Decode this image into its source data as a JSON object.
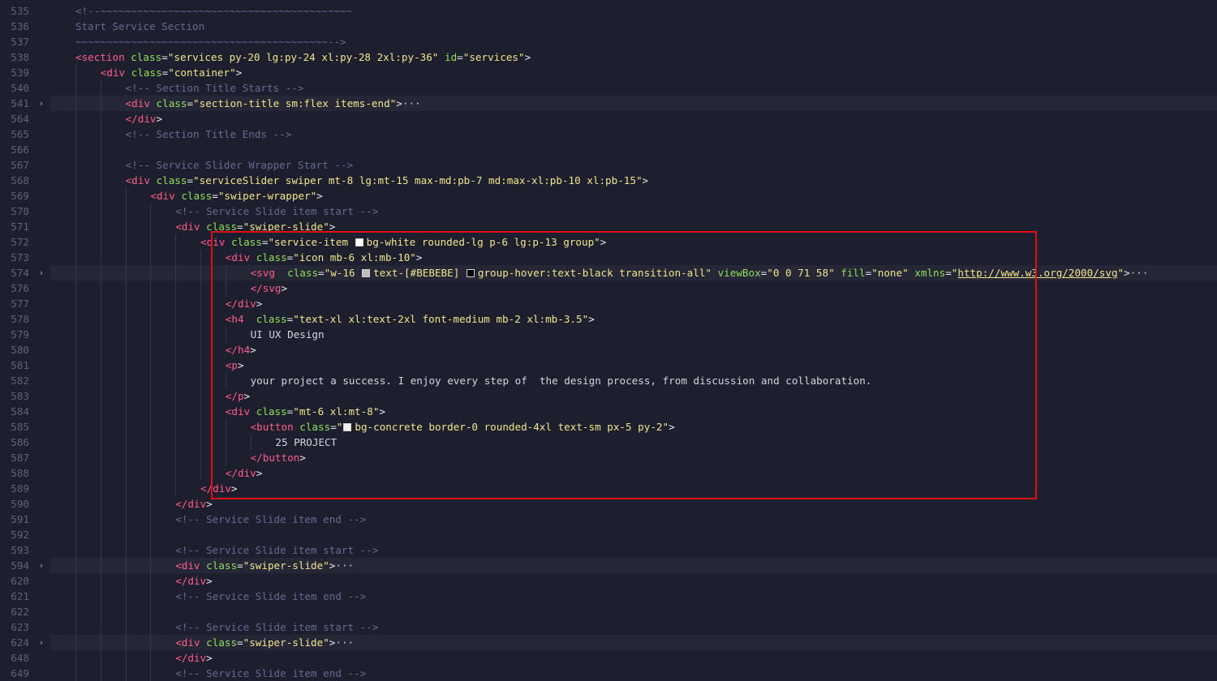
{
  "editor": {
    "lines": [
      {
        "n": "535",
        "indent": 1,
        "tokens": [
          {
            "t": "cmt",
            "v": "<!--~~~~~~~~~~~~~~~~~~~~~~~~~~~~~~~~~~~~~~~~~"
          }
        ]
      },
      {
        "n": "536",
        "indent": 1,
        "tokens": [
          {
            "t": "cmt",
            "v": "Start Service Section"
          }
        ]
      },
      {
        "n": "537",
        "indent": 1,
        "tokens": [
          {
            "t": "cmt",
            "v": "~~~~~~~~~~~~~~~~~~~~~~~~~~~~~~~~~~~~~~~~~-->"
          }
        ]
      },
      {
        "n": "538",
        "indent": 1,
        "tokens": [
          {
            "t": "tag",
            "v": "<section"
          },
          {
            "t": "txt",
            "v": " "
          },
          {
            "t": "attr",
            "v": "class"
          },
          {
            "t": "punc",
            "v": "="
          },
          {
            "t": "str",
            "v": "\"services py-20 lg:py-24 xl:py-28 2xl:py-36\""
          },
          {
            "t": "txt",
            "v": " "
          },
          {
            "t": "attr",
            "v": "id"
          },
          {
            "t": "punc",
            "v": "="
          },
          {
            "t": "str",
            "v": "\"services\""
          },
          {
            "t": "punc",
            "v": ">"
          }
        ]
      },
      {
        "n": "539",
        "indent": 2,
        "tokens": [
          {
            "t": "tag",
            "v": "<div"
          },
          {
            "t": "txt",
            "v": " "
          },
          {
            "t": "attr",
            "v": "class"
          },
          {
            "t": "punc",
            "v": "="
          },
          {
            "t": "str",
            "v": "\"container\""
          },
          {
            "t": "punc",
            "v": ">"
          }
        ]
      },
      {
        "n": "540",
        "indent": 3,
        "tokens": [
          {
            "t": "cmt",
            "v": "<!-- Section Title Starts -->"
          }
        ]
      },
      {
        "n": "541",
        "indent": 3,
        "folded": true,
        "tokens": [
          {
            "t": "tag",
            "v": "<div"
          },
          {
            "t": "txt",
            "v": " "
          },
          {
            "t": "attr",
            "v": "class"
          },
          {
            "t": "punc",
            "v": "="
          },
          {
            "t": "str",
            "v": "\"section-title sm:flex items-end\""
          },
          {
            "t": "punc",
            "v": ">"
          },
          {
            "t": "ellip",
            "v": "···"
          }
        ]
      },
      {
        "n": "564",
        "indent": 3,
        "tokens": [
          {
            "t": "tag",
            "v": "</div"
          },
          {
            "t": "punc",
            "v": ">"
          }
        ]
      },
      {
        "n": "565",
        "indent": 3,
        "tokens": [
          {
            "t": "cmt",
            "v": "<!-- Section Title Ends -->"
          }
        ]
      },
      {
        "n": "566",
        "indent": 3,
        "tokens": []
      },
      {
        "n": "567",
        "indent": 3,
        "tokens": [
          {
            "t": "cmt",
            "v": "<!-- Service Slider Wrapper Start -->"
          }
        ]
      },
      {
        "n": "568",
        "indent": 3,
        "tokens": [
          {
            "t": "tag",
            "v": "<div"
          },
          {
            "t": "txt",
            "v": " "
          },
          {
            "t": "attr",
            "v": "class"
          },
          {
            "t": "punc",
            "v": "="
          },
          {
            "t": "str",
            "v": "\"serviceSlider swiper mt-8 lg:mt-15 max-md:pb-7 md:max-xl:pb-10 xl:pb-15\""
          },
          {
            "t": "punc",
            "v": ">"
          }
        ]
      },
      {
        "n": "569",
        "indent": 4,
        "tokens": [
          {
            "t": "tag",
            "v": "<div"
          },
          {
            "t": "txt",
            "v": " "
          },
          {
            "t": "attr",
            "v": "class"
          },
          {
            "t": "punc",
            "v": "="
          },
          {
            "t": "str",
            "v": "\"swiper-wrapper\""
          },
          {
            "t": "punc",
            "v": ">"
          }
        ]
      },
      {
        "n": "570",
        "indent": 5,
        "tokens": [
          {
            "t": "cmt",
            "v": "<!-- Service Slide item start -->"
          }
        ]
      },
      {
        "n": "571",
        "indent": 5,
        "tokens": [
          {
            "t": "tag",
            "v": "<div"
          },
          {
            "t": "txt",
            "v": " "
          },
          {
            "t": "attr",
            "v": "class"
          },
          {
            "t": "punc",
            "v": "="
          },
          {
            "t": "str",
            "v": "\"swiper-slide\""
          },
          {
            "t": "punc",
            "v": ">"
          }
        ]
      },
      {
        "n": "572",
        "indent": 6,
        "tokens": [
          {
            "t": "tag",
            "v": "<div"
          },
          {
            "t": "txt",
            "v": " "
          },
          {
            "t": "attr",
            "v": "class"
          },
          {
            "t": "punc",
            "v": "="
          },
          {
            "t": "str",
            "v": "\"service-item "
          },
          {
            "t": "swatch",
            "v": "#ffffff"
          },
          {
            "t": "str",
            "v": "bg-white rounded-lg p-6 lg:p-13 group\""
          },
          {
            "t": "punc",
            "v": ">"
          }
        ]
      },
      {
        "n": "573",
        "indent": 7,
        "tokens": [
          {
            "t": "tag",
            "v": "<div"
          },
          {
            "t": "txt",
            "v": " "
          },
          {
            "t": "attr",
            "v": "class"
          },
          {
            "t": "punc",
            "v": "="
          },
          {
            "t": "str",
            "v": "\"icon mb-6 xl:mb-10\""
          },
          {
            "t": "punc",
            "v": ">"
          }
        ]
      },
      {
        "n": "574",
        "indent": 8,
        "folded": true,
        "tokens": [
          {
            "t": "tag",
            "v": "<svg"
          },
          {
            "t": "txt",
            "v": "  "
          },
          {
            "t": "attr",
            "v": "class"
          },
          {
            "t": "punc",
            "v": "="
          },
          {
            "t": "str",
            "v": "\"w-16 "
          },
          {
            "t": "swatch",
            "v": "#BEBEBE"
          },
          {
            "t": "str",
            "v": "text-[#BEBEBE] "
          },
          {
            "t": "swatch",
            "v": "#000000"
          },
          {
            "t": "str",
            "v": "group-hover:text-black transition-all\""
          },
          {
            "t": "txt",
            "v": " "
          },
          {
            "t": "attr",
            "v": "viewBox"
          },
          {
            "t": "punc",
            "v": "="
          },
          {
            "t": "str",
            "v": "\"0 0 71 58\""
          },
          {
            "t": "txt",
            "v": " "
          },
          {
            "t": "attr",
            "v": "fill"
          },
          {
            "t": "punc",
            "v": "="
          },
          {
            "t": "str",
            "v": "\"none\""
          },
          {
            "t": "txt",
            "v": " "
          },
          {
            "t": "attr",
            "v": "xmlns"
          },
          {
            "t": "punc",
            "v": "="
          },
          {
            "t": "str",
            "v": "\""
          },
          {
            "t": "link",
            "v": "http://www.w3.org/2000/svg"
          },
          {
            "t": "str",
            "v": "\""
          },
          {
            "t": "punc",
            "v": ">"
          },
          {
            "t": "ellip",
            "v": "···"
          }
        ]
      },
      {
        "n": "576",
        "indent": 8,
        "tokens": [
          {
            "t": "tag",
            "v": "</svg"
          },
          {
            "t": "punc",
            "v": ">"
          }
        ]
      },
      {
        "n": "577",
        "indent": 7,
        "tokens": [
          {
            "t": "tag",
            "v": "</div"
          },
          {
            "t": "punc",
            "v": ">"
          }
        ]
      },
      {
        "n": "578",
        "indent": 7,
        "tokens": [
          {
            "t": "tag",
            "v": "<h4"
          },
          {
            "t": "txt",
            "v": "  "
          },
          {
            "t": "attr",
            "v": "class"
          },
          {
            "t": "punc",
            "v": "="
          },
          {
            "t": "str",
            "v": "\"text-xl xl:text-2xl font-medium mb-2 xl:mb-3.5\""
          },
          {
            "t": "punc",
            "v": ">"
          }
        ]
      },
      {
        "n": "579",
        "indent": 8,
        "tokens": [
          {
            "t": "txt",
            "v": "UI UX Design"
          }
        ]
      },
      {
        "n": "580",
        "indent": 7,
        "tokens": [
          {
            "t": "tag",
            "v": "</h4"
          },
          {
            "t": "punc",
            "v": ">"
          }
        ]
      },
      {
        "n": "581",
        "indent": 7,
        "tokens": [
          {
            "t": "tag",
            "v": "<p"
          },
          {
            "t": "punc",
            "v": ">"
          }
        ]
      },
      {
        "n": "582",
        "indent": 8,
        "tokens": [
          {
            "t": "txt",
            "v": "your project a success. I enjoy every step of  the design process, from discussion and collaboration."
          }
        ]
      },
      {
        "n": "583",
        "indent": 7,
        "tokens": [
          {
            "t": "tag",
            "v": "</p"
          },
          {
            "t": "punc",
            "v": ">"
          }
        ]
      },
      {
        "n": "584",
        "indent": 7,
        "tokens": [
          {
            "t": "tag",
            "v": "<div"
          },
          {
            "t": "txt",
            "v": " "
          },
          {
            "t": "attr",
            "v": "class"
          },
          {
            "t": "punc",
            "v": "="
          },
          {
            "t": "str",
            "v": "\"mt-6 xl:mt-8\""
          },
          {
            "t": "punc",
            "v": ">"
          }
        ]
      },
      {
        "n": "585",
        "indent": 8,
        "tokens": [
          {
            "t": "tag",
            "v": "<button"
          },
          {
            "t": "txt",
            "v": " "
          },
          {
            "t": "attr",
            "v": "class"
          },
          {
            "t": "punc",
            "v": "="
          },
          {
            "t": "str",
            "v": "\""
          },
          {
            "t": "swatch",
            "v": "#f2f2f2"
          },
          {
            "t": "str",
            "v": "bg-concrete border-0 rounded-4xl text-sm px-5 py-2\""
          },
          {
            "t": "punc",
            "v": ">"
          }
        ]
      },
      {
        "n": "586",
        "indent": 9,
        "tokens": [
          {
            "t": "txt",
            "v": "25 PROJECT"
          }
        ]
      },
      {
        "n": "587",
        "indent": 8,
        "tokens": [
          {
            "t": "tag",
            "v": "</button"
          },
          {
            "t": "punc",
            "v": ">"
          }
        ]
      },
      {
        "n": "588",
        "indent": 7,
        "tokens": [
          {
            "t": "tag",
            "v": "</div"
          },
          {
            "t": "punc",
            "v": ">"
          }
        ]
      },
      {
        "n": "589",
        "indent": 6,
        "tokens": [
          {
            "t": "tag",
            "v": "</div"
          },
          {
            "t": "punc",
            "v": ">"
          }
        ]
      },
      {
        "n": "590",
        "indent": 5,
        "tokens": [
          {
            "t": "tag",
            "v": "</div"
          },
          {
            "t": "punc",
            "v": ">"
          }
        ]
      },
      {
        "n": "591",
        "indent": 5,
        "tokens": [
          {
            "t": "cmt",
            "v": "<!-- Service Slide item end -->"
          }
        ]
      },
      {
        "n": "592",
        "indent": 5,
        "tokens": []
      },
      {
        "n": "593",
        "indent": 5,
        "tokens": [
          {
            "t": "cmt",
            "v": "<!-- Service Slide item start -->"
          }
        ]
      },
      {
        "n": "594",
        "indent": 5,
        "folded": true,
        "tokens": [
          {
            "t": "tag",
            "v": "<div"
          },
          {
            "t": "txt",
            "v": " "
          },
          {
            "t": "attr",
            "v": "class"
          },
          {
            "t": "punc",
            "v": "="
          },
          {
            "t": "str",
            "v": "\"swiper-slide\""
          },
          {
            "t": "punc",
            "v": ">"
          },
          {
            "t": "ellip",
            "v": "···"
          }
        ]
      },
      {
        "n": "620",
        "indent": 5,
        "tokens": [
          {
            "t": "tag",
            "v": "</div"
          },
          {
            "t": "punc",
            "v": ">"
          }
        ]
      },
      {
        "n": "621",
        "indent": 5,
        "tokens": [
          {
            "t": "cmt",
            "v": "<!-- Service Slide item end -->"
          }
        ]
      },
      {
        "n": "622",
        "indent": 5,
        "tokens": []
      },
      {
        "n": "623",
        "indent": 5,
        "tokens": [
          {
            "t": "cmt",
            "v": "<!-- Service Slide item start -->"
          }
        ]
      },
      {
        "n": "624",
        "indent": 5,
        "folded": true,
        "tokens": [
          {
            "t": "tag",
            "v": "<div"
          },
          {
            "t": "txt",
            "v": " "
          },
          {
            "t": "attr",
            "v": "class"
          },
          {
            "t": "punc",
            "v": "="
          },
          {
            "t": "str",
            "v": "\"swiper-slide\""
          },
          {
            "t": "punc",
            "v": ">"
          },
          {
            "t": "ellip",
            "v": "···"
          }
        ]
      },
      {
        "n": "648",
        "indent": 5,
        "tokens": [
          {
            "t": "tag",
            "v": "</div"
          },
          {
            "t": "punc",
            "v": ">"
          }
        ]
      },
      {
        "n": "649",
        "indent": 5,
        "tokens": [
          {
            "t": "cmt",
            "v": "<!-- Service Slide item end -->"
          }
        ]
      }
    ],
    "fold_marker": "›",
    "highlight_color": "#e01010"
  }
}
